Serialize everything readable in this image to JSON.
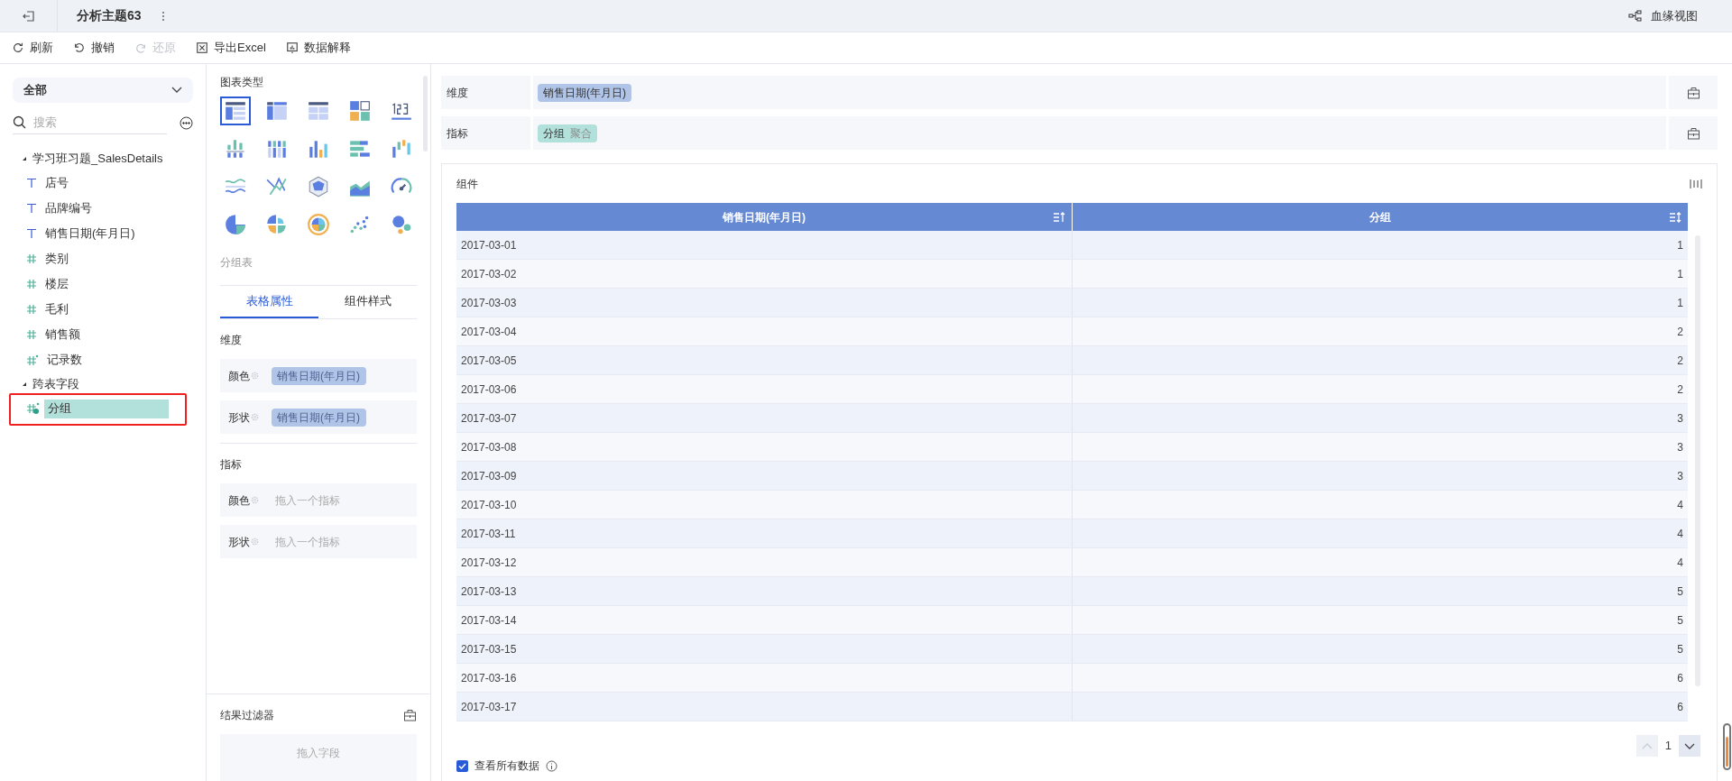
{
  "top_bar": {
    "title": "分析主题63",
    "lineage_button": "血缘视图"
  },
  "toolbar": [
    {
      "label": "刷新",
      "kind": "refresh",
      "disabled": false
    },
    {
      "label": "撤销",
      "kind": "undo",
      "disabled": false
    },
    {
      "label": "还原",
      "kind": "redo",
      "disabled": true
    },
    {
      "label": "导出Excel",
      "kind": "excel",
      "disabled": false
    },
    {
      "label": "数据解释",
      "kind": "explain",
      "disabled": false
    }
  ],
  "field_panel": {
    "scope": "全部",
    "search_placeholder": "搜索",
    "tree": [
      {
        "label": "学习班习题_SalesDetails",
        "expanded": true,
        "children": [
          {
            "label": "店号",
            "kind": "text",
            "selected": false
          },
          {
            "label": "品牌编号",
            "kind": "text",
            "selected": false
          },
          {
            "label": "销售日期(年月日)",
            "kind": "text",
            "selected": false
          },
          {
            "label": "类别",
            "kind": "number",
            "selected": false
          },
          {
            "label": "楼层",
            "kind": "number",
            "selected": false
          },
          {
            "label": "毛利",
            "kind": "number",
            "selected": false
          },
          {
            "label": "销售额",
            "kind": "number",
            "selected": false
          },
          {
            "label": "记录数",
            "kind": "count",
            "selected": false
          }
        ]
      },
      {
        "label": "跨表字段",
        "expanded": true,
        "children": [
          {
            "label": "分组",
            "kind": "custom",
            "selected": true
          }
        ]
      }
    ]
  },
  "chart_panel": {
    "title": "图表类型",
    "types": [
      {
        "kind": "grouped-table",
        "selected": true
      },
      {
        "kind": "cross-table",
        "selected": false
      },
      {
        "kind": "detail-table",
        "selected": false
      },
      {
        "kind": "kpi-card",
        "selected": false
      },
      {
        "kind": "number",
        "selected": false
      },
      {
        "kind": "range-bar",
        "selected": false
      },
      {
        "kind": "stacked-bar",
        "selected": false
      },
      {
        "kind": "bar",
        "selected": false
      },
      {
        "kind": "horizontal-bar",
        "selected": false
      },
      {
        "kind": "waterfall",
        "selected": false
      },
      {
        "kind": "wave",
        "selected": false
      },
      {
        "kind": "line",
        "selected": false
      },
      {
        "kind": "radar",
        "selected": false
      },
      {
        "kind": "area",
        "selected": false
      },
      {
        "kind": "gauge",
        "selected": false
      },
      {
        "kind": "pie",
        "selected": false
      },
      {
        "kind": "rose",
        "selected": false
      },
      {
        "kind": "sunburst",
        "selected": false
      },
      {
        "kind": "scatter",
        "selected": false
      },
      {
        "kind": "bubble",
        "selected": false
      }
    ],
    "current_type": "分组表",
    "tabs": [
      {
        "label": "表格属性",
        "selected": true
      },
      {
        "label": "组件样式",
        "selected": false
      }
    ],
    "sections": [
      {
        "title": "维度",
        "slots": [
          {
            "label": "颜色",
            "value": "销售日期(年月日)"
          },
          {
            "label": "形状",
            "value": "销售日期(年月日)"
          }
        ]
      },
      {
        "title": "指标",
        "slots": [
          {
            "label": "颜色",
            "hint": "拖入一个指标"
          },
          {
            "label": "形状",
            "hint": "拖入一个指标"
          }
        ]
      }
    ],
    "filter": {
      "title": "结果过滤器",
      "hint": "拖入字段"
    }
  },
  "shelves": [
    {
      "label": "维度",
      "chips": [
        {
          "label": "销售日期(年月日)",
          "kind": "dimension"
        }
      ]
    },
    {
      "label": "指标",
      "chips": [
        {
          "label": "分组",
          "suffix": "聚合",
          "kind": "measure"
        }
      ]
    }
  ],
  "component": {
    "title": "组件",
    "table": {
      "columns": [
        {
          "label": "销售日期(年月日)",
          "sorted": true
        },
        {
          "label": "分组",
          "sorted": false
        }
      ],
      "rows": [
        [
          "2017-03-01",
          "1"
        ],
        [
          "2017-03-02",
          "1"
        ],
        [
          "2017-03-03",
          "1"
        ],
        [
          "2017-03-04",
          "2"
        ],
        [
          "2017-03-05",
          "2"
        ],
        [
          "2017-03-06",
          "2"
        ],
        [
          "2017-03-07",
          "3"
        ],
        [
          "2017-03-08",
          "3"
        ],
        [
          "2017-03-09",
          "3"
        ],
        [
          "2017-03-10",
          "4"
        ],
        [
          "2017-03-11",
          "4"
        ],
        [
          "2017-03-12",
          "4"
        ],
        [
          "2017-03-13",
          "5"
        ],
        [
          "2017-03-14",
          "5"
        ],
        [
          "2017-03-15",
          "5"
        ],
        [
          "2017-03-16",
          "6"
        ],
        [
          "2017-03-17",
          "6"
        ]
      ]
    },
    "pagination": {
      "page": "1"
    },
    "show_all": {
      "label": "查看所有数据",
      "checked": true
    }
  }
}
